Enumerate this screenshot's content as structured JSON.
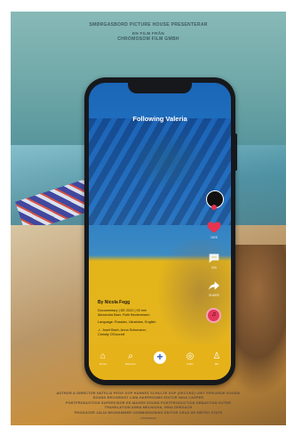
{
  "poster_header": {
    "presenter": "SMØRGASBORD PICTURE HOUSE PRESENTERAR",
    "film_from": "EN FILM FRÅN",
    "studio": "CHROMOSOM FILM GMBH"
  },
  "phone_screen": {
    "feed_title": "Following Valeria",
    "rail": {
      "likes": "192K",
      "comments": "900",
      "shares": "SHARE"
    },
    "post": {
      "author": "By Nicola Fegg",
      "line1": "Documentary | DE 2022 | 93 min",
      "line2": "Alexandra Baer, Ruth Beckermann",
      "line3": "Language: Russian, Ukrainian, English",
      "music_line1": "Josef Bach, Anna Schumann,",
      "music_line2": "Christly O'Donnell"
    },
    "nav": [
      {
        "glyph": "⌂",
        "label": "Home"
      },
      {
        "glyph": "⌕",
        "label": "Discover"
      },
      {
        "glyph": "+",
        "label": ""
      },
      {
        "glyph": "◎",
        "label": "Inbox"
      },
      {
        "glyph": "♙",
        "label": "Me"
      }
    ]
  },
  "credits": {
    "line1": "AUTHOR & DIRECTOR NATELIA PEGG  DOP HANNES SCHULZE  DOP (SECOND) UNIT ERIKARDE SOUSSI",
    "line2": "SOUND RECORDIST LINA HARFRSOMS  EDITOR NINA CASPER",
    "line3": "POSTPRODUCTION SUPERVISOR ED MAGES  SOUND POSTPRODUCTION SEBASTIAN KUTER",
    "line4": "TRANSLATION ANNA MELNICHA, NINA DEEDACH",
    "line5": "PRODUCER JULIA NEUHAMMER  COMMISSIONING EDITOR CRAS HE METRO STATE",
    "logo": "chromosom"
  },
  "colors": {
    "screen_blue": "#1a66b8",
    "screen_yellow": "#e4b51a",
    "heart": "#e8334f",
    "add_button_icon": "#2c5bbd"
  }
}
